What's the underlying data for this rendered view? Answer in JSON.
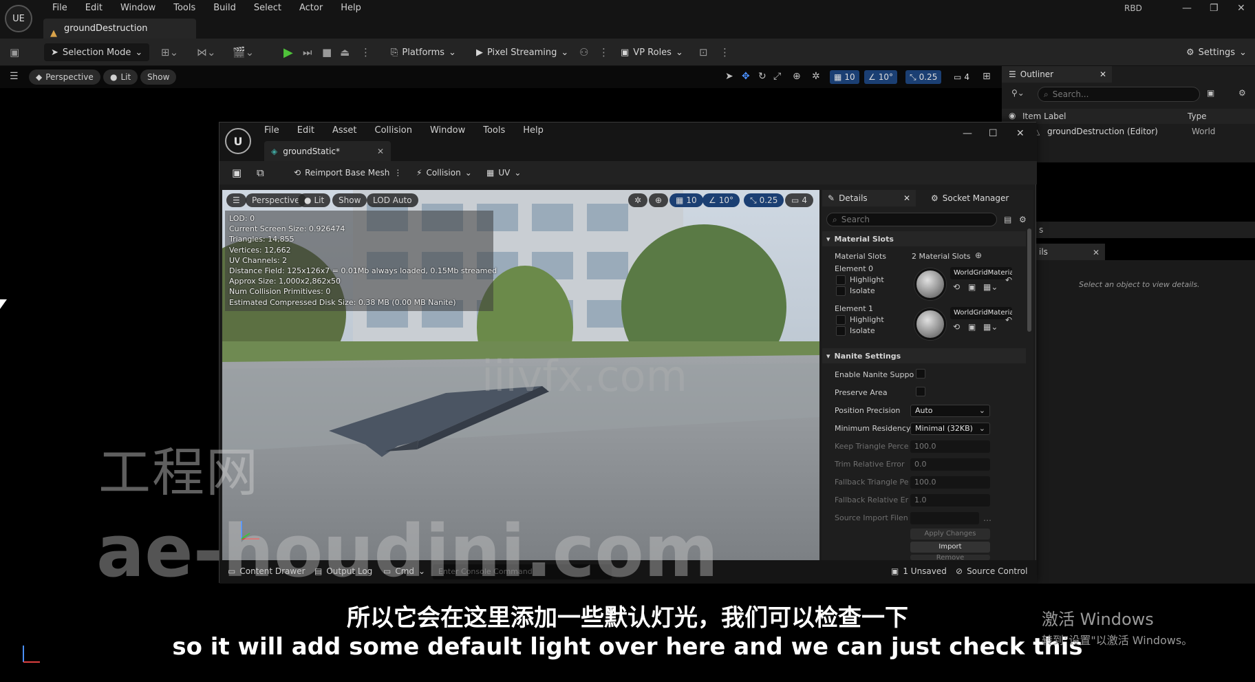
{
  "app": {
    "logo_text": "UE",
    "menu": [
      "File",
      "Edit",
      "Window",
      "Tools",
      "Build",
      "Select",
      "Actor",
      "Help"
    ],
    "document_tab": "groundDestruction",
    "user_badge": "RBD"
  },
  "toolbar": {
    "selection_mode": "Selection Mode",
    "platforms": "Platforms",
    "pixel_streaming": "Pixel Streaming",
    "vp_roles": "VP Roles",
    "settings": "Settings"
  },
  "level_viewport": {
    "perspective": "Perspective",
    "lit": "Lit",
    "show": "Show",
    "grid_snap": "10",
    "rotation_snap": "10°",
    "scale_snap": "0.25",
    "camera_speed": "4"
  },
  "outliner": {
    "tab_label": "Outliner",
    "search_placeholder": "Search...",
    "col_label": "Item Label",
    "col_type": "Type",
    "rows": [
      {
        "label": "groundDestruction (Editor)",
        "type": "World"
      }
    ],
    "strip_text": "s",
    "details_tab_text": "ils",
    "empty_message": "Select an object to view details."
  },
  "mesh_editor": {
    "menu": [
      "File",
      "Edit",
      "Asset",
      "Collision",
      "Window",
      "Tools",
      "Help"
    ],
    "tab_label": "groundStatic*",
    "toolbar": {
      "reimport": "Reimport Base Mesh",
      "collision": "Collision",
      "uv": "UV"
    },
    "viewport": {
      "perspective": "Perspective",
      "lit": "Lit",
      "show": "Show",
      "lod": "LOD Auto",
      "grid_snap": "10",
      "rotation_snap": "10°",
      "scale_snap": "0.25",
      "camera_speed": "4",
      "stats": [
        "LOD:  0",
        "Current Screen Size:  0.926474",
        "Triangles:  14,855",
        "Vertices:  12,662",
        "UV Channels:  2",
        "Distance Field:  125x126x7 = 0.01Mb always loaded, 0.15Mb streamed",
        "Approx Size:  1,000x2,862x50",
        "Num Collision Primitives:  0",
        "Estimated Compressed Disk Size: 0.38 MB (0.00 MB Nanite)"
      ]
    },
    "details": {
      "tab_details": "Details",
      "tab_socket": "Socket Manager",
      "search_placeholder": "Search",
      "section_material": "Material Slots",
      "material_slots_label": "Material Slots",
      "material_slots_value": "2 Material Slots",
      "elements": [
        {
          "label": "Element 0",
          "highlight": "Highlight",
          "isolate": "Isolate",
          "material": "WorldGridMaterial"
        },
        {
          "label": "Element 1",
          "highlight": "Highlight",
          "isolate": "Isolate",
          "material": "WorldGridMaterial"
        }
      ],
      "section_nanite": "Nanite Settings",
      "nanite": {
        "enable_label": "Enable Nanite Suppo",
        "preserve_label": "Preserve Area",
        "position_label": "Position Precision",
        "position_value": "Auto",
        "residency_label": "Minimum Residency",
        "residency_value": "Minimal (32KB)",
        "keep_label": "Keep Triangle Perce",
        "keep_value": "100.0",
        "trim_label": "Trim Relative Error",
        "trim_value": "0.0",
        "fallback_pct_label": "Fallback Triangle Pe",
        "fallback_pct_value": "100.0",
        "fallback_err_label": "Fallback Relative Er",
        "fallback_err_value": "1.0",
        "source_label": "Source Import Filen",
        "apply": "Apply Changes",
        "import": "Import",
        "remove": "Remove"
      }
    },
    "status": {
      "content_drawer": "Content Drawer",
      "output_log": "Output Log",
      "cmd": "Cmd",
      "console_placeholder": "Enter Console Command",
      "unsaved": "1 Unsaved",
      "source_control": "Source Control"
    }
  },
  "overlays": {
    "watermark_cn": "工程网",
    "watermark_en": "ae-houdini.com",
    "watermark_site": "iiivfx.com",
    "subtitle_cn": "所以它会在这里添加一些默认灯光，我们可以检查一下",
    "subtitle_en": "so it will add some default light over here and we can just check this",
    "activate_line1": "激活 Windows",
    "activate_line2": "转到\"设置\"以激活 Windows。"
  },
  "colors": {
    "accent_blue": "#1b3f73",
    "play_green": "#4fc23a",
    "warning_orange": "#d9a34a"
  }
}
